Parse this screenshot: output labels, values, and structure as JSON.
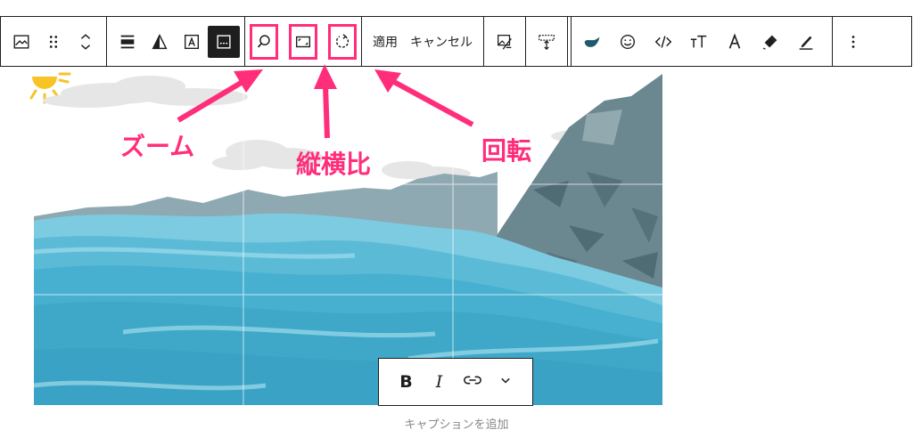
{
  "toolbar": {
    "apply_label": "適用",
    "cancel_label": "キャンセル",
    "highlight_color": "#ff2d7a",
    "icons": [
      "image-icon",
      "drag-handle-icon",
      "move-up-down-icon",
      "align-icon",
      "duotone-icon",
      "text-overlay-icon",
      "caption-icon",
      "zoom-icon",
      "aspect-ratio-icon",
      "rotate-icon",
      "replace-icon",
      "crop-height-icon",
      "brand-icon",
      "emoji-icon",
      "code-icon",
      "font-size-icon",
      "text-color-icon",
      "highlighter-icon",
      "marker-icon",
      "more-options-icon"
    ]
  },
  "annotations": {
    "zoom": "ズーム",
    "aspect_ratio": "縦横比",
    "rotate": "回転"
  },
  "format_bar": {
    "bold": "B",
    "italic": "I"
  },
  "caption_placeholder": "キャプションを追加",
  "colors": {
    "sea": "#3fa8c9",
    "rock": "#6b8790",
    "sky": "#ffffff",
    "sun": "#f7c325"
  }
}
